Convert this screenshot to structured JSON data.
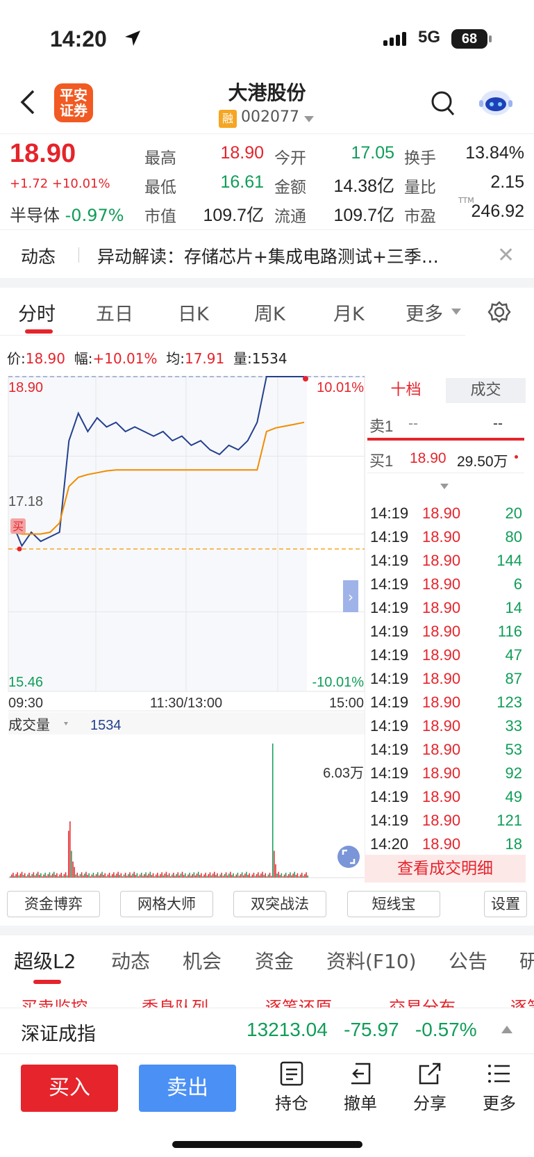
{
  "status_bar": {
    "time": "14:20",
    "network": "5G",
    "battery": "68"
  },
  "header": {
    "logo_text": "平安\n证券",
    "stock_name": "大港股份",
    "margin_badge": "融",
    "stock_code": "002077"
  },
  "quote": {
    "price": "18.90",
    "change": "+1.72 +10.01%",
    "sector_label": "半导体",
    "sector_change": "-0.97%",
    "fields": [
      {
        "label": "最高",
        "value": "18.90",
        "color": "red"
      },
      {
        "label": "今开",
        "value": "17.05",
        "color": "green"
      },
      {
        "label": "换手",
        "value": "13.84%",
        "color": "black"
      },
      {
        "label": "最低",
        "value": "16.61",
        "color": "green"
      },
      {
        "label": "金额",
        "value": "14.38亿",
        "color": "black"
      },
      {
        "label": "量比",
        "value": "2.15",
        "color": "black"
      },
      {
        "label": "市值",
        "value": "109.7亿",
        "color": "black"
      },
      {
        "label": "流通",
        "value": "109.7亿",
        "color": "black"
      },
      {
        "label": "市盈",
        "value": "246.92",
        "color": "black"
      }
    ],
    "ttm": "TTM"
  },
  "news": {
    "label": "动态",
    "text": "异动解读：存储芯片+集成电路测试+三季…"
  },
  "chart_tabs": [
    "分时",
    "五日",
    "日K",
    "周K",
    "月K",
    "更多"
  ],
  "info_line": {
    "price_label": "价:",
    "price": "18.90",
    "amp_label": "幅:",
    "amp": "+10.01%",
    "avg_label": "均:",
    "avg": "17.91",
    "vol_label": "量:",
    "vol": "1534"
  },
  "chart_data": {
    "type": "line",
    "y_labels_left": [
      "18.90",
      "17.18",
      "15.46"
    ],
    "y_labels_right": [
      "10.01%",
      "-10.01%"
    ],
    "x_labels": [
      "09:30",
      "11:30/13:00",
      "15:00"
    ],
    "ylim": [
      15.46,
      18.9
    ],
    "series": [
      {
        "values": [
          17.3,
          17.05,
          17.2,
          17.1,
          17.15,
          17.2,
          18.2,
          18.5,
          18.3,
          18.45,
          18.35,
          18.4,
          18.3,
          18.35,
          18.3,
          18.25,
          18.3,
          18.2,
          18.25,
          18.15,
          18.2,
          18.1,
          18.05,
          18.15,
          18.1,
          18.2,
          18.4,
          18.9,
          18.9,
          18.9,
          18.9,
          18.9
        ]
      },
      {
        "values": [
          17.2,
          17.18,
          17.18,
          17.18,
          17.2,
          17.3,
          17.7,
          17.8,
          17.83,
          17.85,
          17.87,
          17.88,
          17.88,
          17.88,
          17.88,
          17.88,
          17.88,
          17.88,
          17.88,
          17.88,
          17.88,
          17.88,
          17.88,
          17.88,
          17.88,
          17.88,
          17.88,
          18.3,
          18.34,
          18.36,
          18.38,
          18.4
        ]
      }
    ],
    "buy_marker": "买",
    "volume_label": "成交量",
    "volume_value": "1534",
    "volume_max_label": "6.03万"
  },
  "order_book": {
    "tab_active": "十档",
    "tab_other": "成交",
    "sell1_label": "卖1",
    "sell1_price": "--",
    "sell1_vol": "--",
    "buy1_label": "买1",
    "buy1_price": "18.90",
    "buy1_vol": "29.50万"
  },
  "trades": [
    {
      "time": "14:19",
      "price": "18.90",
      "vol": "20"
    },
    {
      "time": "14:19",
      "price": "18.90",
      "vol": "80"
    },
    {
      "time": "14:19",
      "price": "18.90",
      "vol": "144"
    },
    {
      "time": "14:19",
      "price": "18.90",
      "vol": "6"
    },
    {
      "time": "14:19",
      "price": "18.90",
      "vol": "14"
    },
    {
      "time": "14:19",
      "price": "18.90",
      "vol": "116"
    },
    {
      "time": "14:19",
      "price": "18.90",
      "vol": "47"
    },
    {
      "time": "14:19",
      "price": "18.90",
      "vol": "87"
    },
    {
      "time": "14:19",
      "price": "18.90",
      "vol": "123"
    },
    {
      "time": "14:19",
      "price": "18.90",
      "vol": "33"
    },
    {
      "time": "14:19",
      "price": "18.90",
      "vol": "53"
    },
    {
      "time": "14:19",
      "price": "18.90",
      "vol": "92"
    },
    {
      "time": "14:19",
      "price": "18.90",
      "vol": "49"
    },
    {
      "time": "14:19",
      "price": "18.90",
      "vol": "121"
    },
    {
      "time": "14:20",
      "price": "18.90",
      "vol": "18"
    }
  ],
  "view_detail": "查看成交明细",
  "tools": [
    "资金博弈",
    "网格大师",
    "双突战法",
    "短线宝",
    "设置"
  ],
  "sub_tabs": [
    "超级L2",
    "动态",
    "机会",
    "资金",
    "资料(F10)",
    "公告",
    "研"
  ],
  "sub_tabs2": [
    "买卖监控",
    "委身队列",
    "逐笔还原",
    "交易分布",
    "逐笔"
  ],
  "index": {
    "name": "深证成指",
    "value": "13213.04",
    "change": "-75.97",
    "pct": "-0.57%"
  },
  "bottom": {
    "buy": "买入",
    "sell": "卖出",
    "items": [
      "持仓",
      "撤单",
      "分享",
      "更多"
    ]
  }
}
